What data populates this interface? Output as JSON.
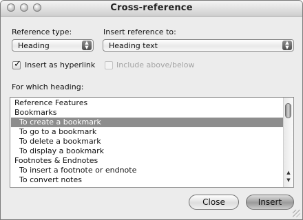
{
  "window": {
    "title": "Cross-reference"
  },
  "reference_type": {
    "label": "Reference type:",
    "value": "Heading"
  },
  "insert_reference_to": {
    "label": "Insert reference to:",
    "value": "Heading text"
  },
  "insert_as_hyperlink": {
    "label": "Insert as hyperlink",
    "checked": true
  },
  "include_above_below": {
    "label": "Include above/below",
    "enabled": false
  },
  "headings_list": {
    "label": "For which heading:",
    "items": [
      "Reference Features",
      "Bookmarks",
      "To create a bookmark",
      "To go to a bookmark",
      "To delete a bookmark",
      "To display a bookmark",
      "Footnotes & Endnotes",
      "To insert a footnote or endnote",
      "To convert notes"
    ],
    "selected_index": 2
  },
  "buttons": {
    "close": "Close",
    "insert": "Insert"
  },
  "icons": {
    "popup_arrows": "updown-chevron-icon",
    "scroll_up": "scroll-up-arrow-icon",
    "scroll_down": "scroll-down-arrow-icon"
  }
}
